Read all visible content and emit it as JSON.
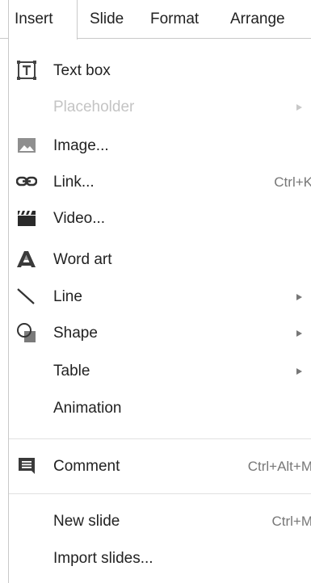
{
  "menubar": {
    "items": [
      {
        "label": "Insert"
      },
      {
        "label": "Slide"
      },
      {
        "label": "Format"
      },
      {
        "label": "Arrange"
      }
    ],
    "active_index": 0
  },
  "dropdown": {
    "items": [
      {
        "label": "Text box",
        "icon": "text-box-icon"
      },
      {
        "label": "Placeholder",
        "disabled": true,
        "submenu": true
      },
      {
        "label": "Image...",
        "icon": "image-icon"
      },
      {
        "label": "Link...",
        "icon": "link-icon",
        "shortcut": "Ctrl+K"
      },
      {
        "label": "Video...",
        "icon": "video-icon"
      },
      {
        "label": "Word art",
        "icon": "word-art-icon"
      },
      {
        "label": "Line",
        "icon": "line-icon",
        "submenu": true
      },
      {
        "label": "Shape",
        "icon": "shape-icon",
        "submenu": true
      },
      {
        "label": "Table",
        "submenu": true
      },
      {
        "label": "Animation"
      },
      {
        "label": "Comment",
        "icon": "comment-icon",
        "shortcut": "Ctrl+Alt+M"
      },
      {
        "label": "New slide",
        "shortcut": "Ctrl+M"
      },
      {
        "label": "Import slides..."
      }
    ]
  }
}
